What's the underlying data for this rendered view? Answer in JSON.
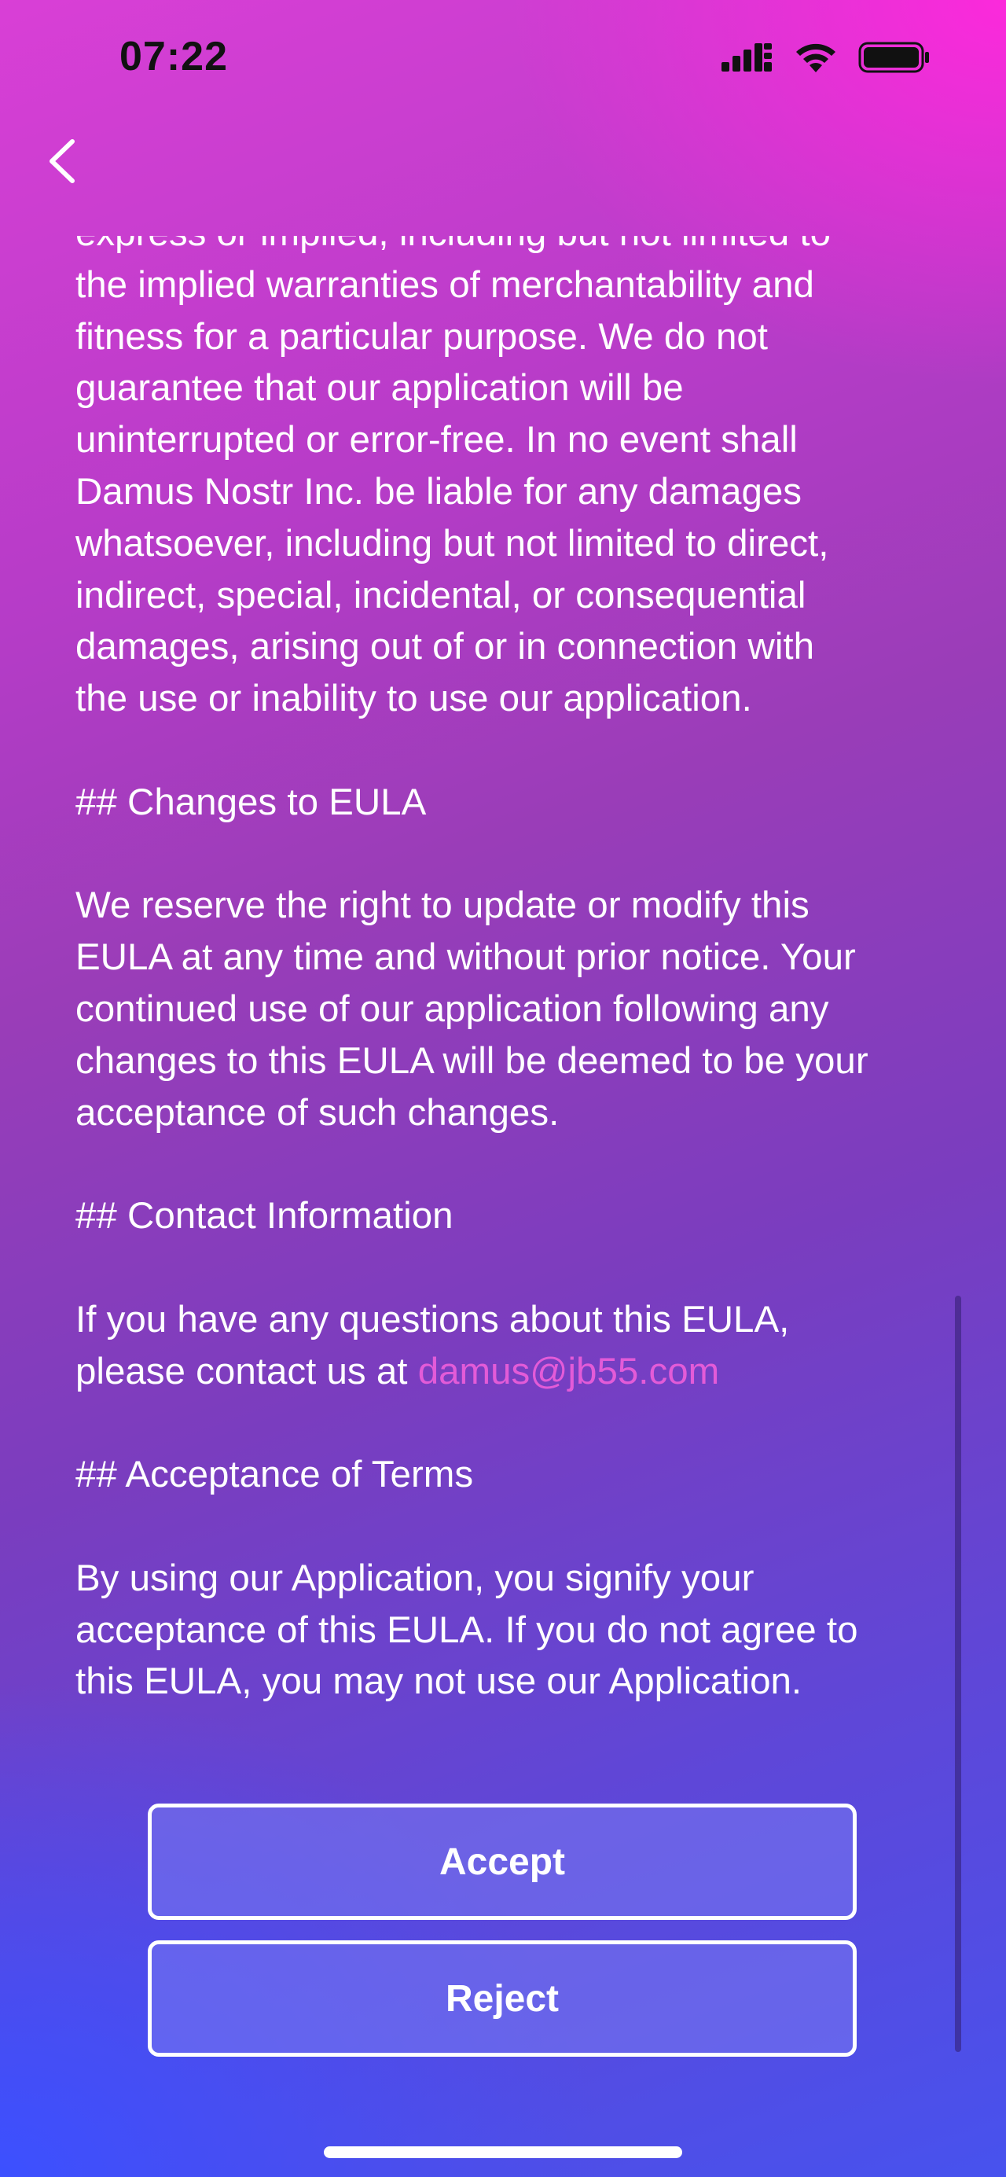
{
  "status_bar": {
    "time": "07:22",
    "icons": [
      "cellular-signal-icon",
      "wifi-icon",
      "battery-icon"
    ]
  },
  "nav": {
    "back_icon": "chevron-left-icon"
  },
  "eula": {
    "partial_top_line": "express or implied, including but not limited to",
    "warranty_paragraph": "the implied warranties of merchantability and\nfitness for a particular purpose. We do not\nguarantee that our application will be\nuninterrupted or error-free. In no event shall\nDamus Nostr Inc. be liable for any damages\nwhatsoever, including but not limited to direct,\nindirect, special, incidental, or consequential\ndamages, arising out of or in connection with\nthe use or inability to use our application.",
    "changes_heading": "## Changes to EULA",
    "changes_paragraph": "We reserve the right to update or modify this\nEULA at any time and without prior notice. Your\ncontinued use of our application following any\nchanges to this EULA will be deemed to be your\nacceptance of such changes.",
    "contact_heading": "## Contact Information",
    "contact_text": "If you have any questions about this EULA,\nplease contact us at ",
    "contact_email": "damus@jb55.com",
    "acceptance_heading": "## Acceptance of Terms",
    "acceptance_paragraph": "By using our Application, you signify your\nacceptance of this EULA. If you do not agree to\nthis EULA, you may not use our Application."
  },
  "buttons": {
    "accept": "Accept",
    "reject": "Reject"
  },
  "colors": {
    "link": "#e35bd8",
    "gradient_top_right": "#ff2ddc",
    "gradient_bottom_left": "#3c50ff"
  }
}
